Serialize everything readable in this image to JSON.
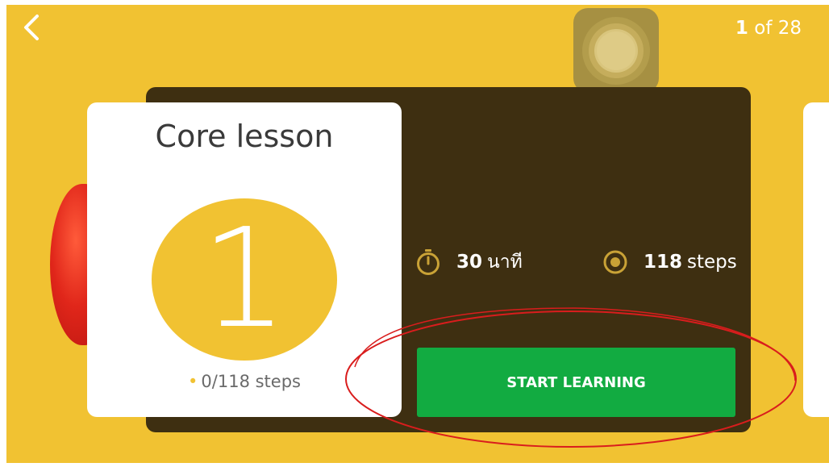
{
  "nav": {
    "back_icon": "chevron-left-icon",
    "page_current": "1",
    "page_of": "of 28"
  },
  "lesson_card": {
    "title": "Core lesson",
    "number": "1",
    "progress": "0/118 steps"
  },
  "stats": {
    "time_value": "30",
    "time_unit": "นาที",
    "steps_value": "118",
    "steps_unit": "steps"
  },
  "actions": {
    "start_label": "START LEARNING"
  },
  "colors": {
    "background": "#f1c232",
    "panel": "#3e2f11",
    "accent": "#f1c232",
    "button": "#12ab41",
    "annotation": "#d91d1d"
  }
}
